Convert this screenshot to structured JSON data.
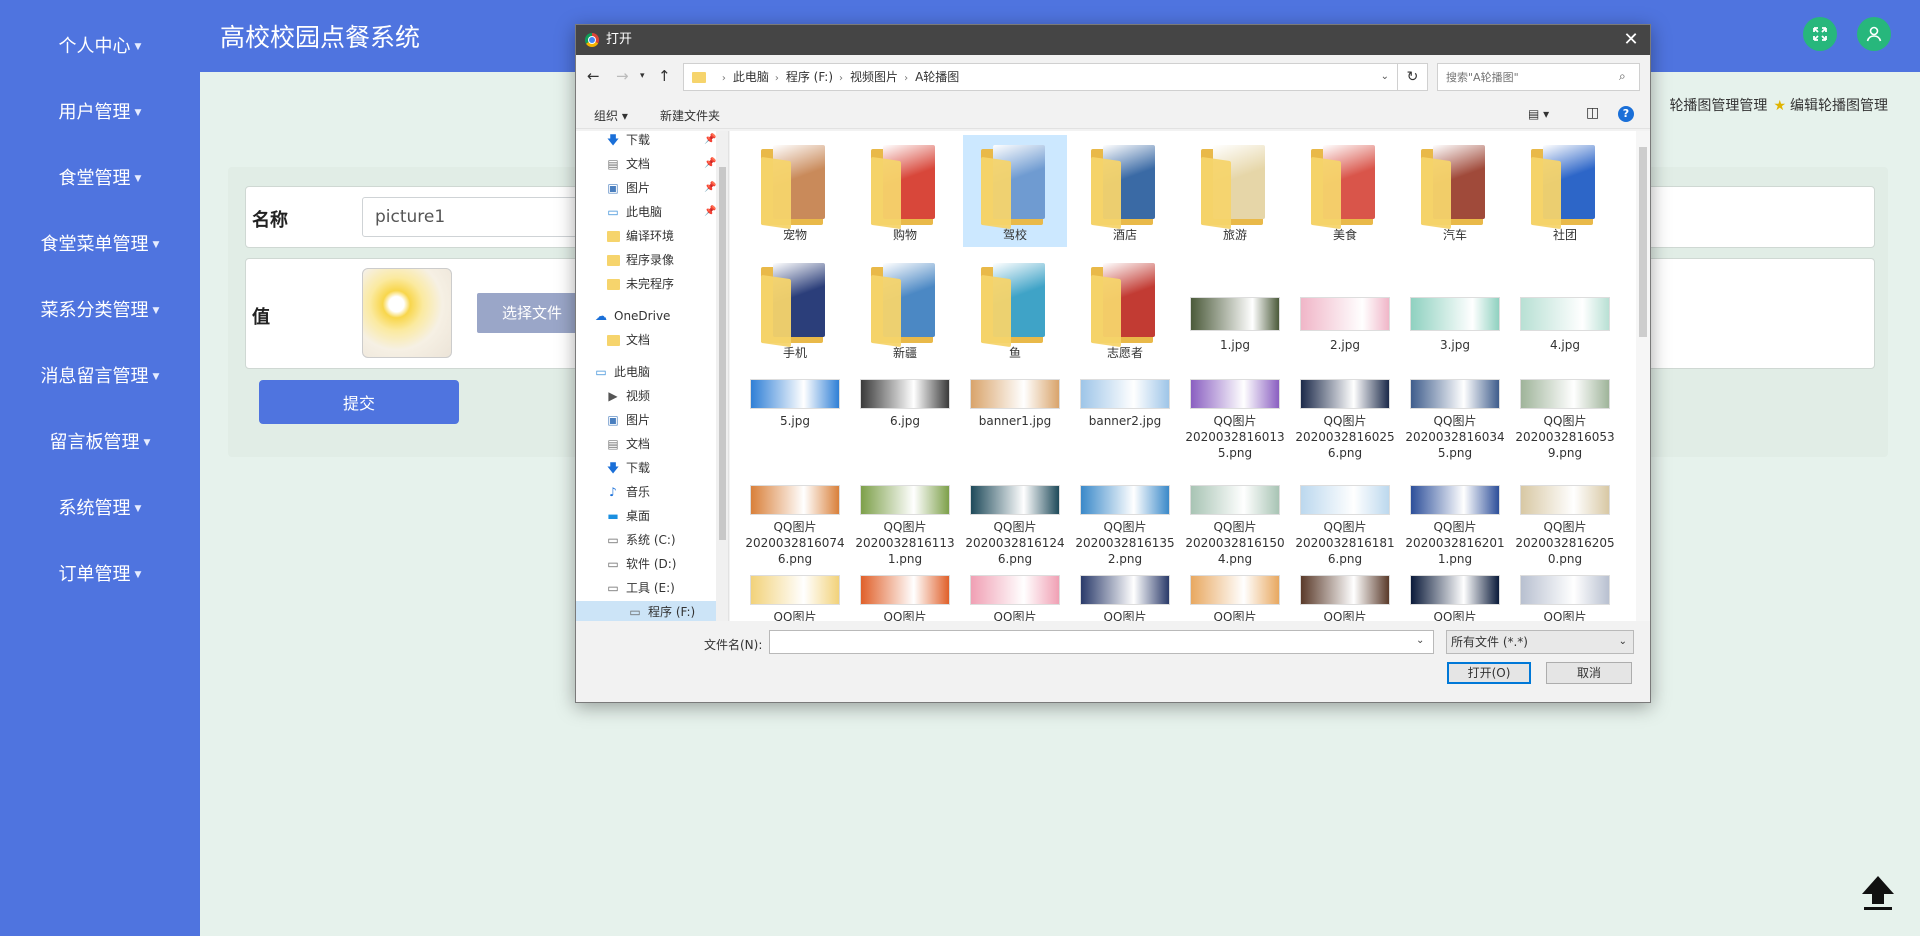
{
  "app": {
    "title": "高校校园点餐系统",
    "sidebar": [
      "个人中心",
      "用户管理",
      "食堂管理",
      "食堂菜单管理",
      "菜系分类管理",
      "消息留言管理",
      "留言板管理",
      "系统管理",
      "订单管理"
    ],
    "breadcrumb": {
      "current": "轮播图管理管理",
      "edit": "编辑轮播图管理"
    },
    "form": {
      "name_label": "名称",
      "name_value": "picture1",
      "value_label": "值",
      "file_button": "选择文件",
      "submit": "提交"
    },
    "colors": {
      "primary": "#4f74df",
      "accent": "#27b77c",
      "background": "#e6f2ec"
    }
  },
  "dialog": {
    "title": "打开",
    "path": [
      "此电脑",
      "程序 (F:)",
      "视频图片",
      "A轮播图"
    ],
    "search_placeholder": "搜索\"A轮播图\"",
    "toolbar": {
      "organize": "组织",
      "new_folder": "新建文件夹"
    },
    "nav": {
      "quick": [
        {
          "label": "下载",
          "icon": "download-arrow-icon",
          "pinned": true
        },
        {
          "label": "文档",
          "icon": "document-icon",
          "pinned": true
        },
        {
          "label": "图片",
          "icon": "picture-icon",
          "pinned": true
        },
        {
          "label": "此电脑",
          "icon": "monitor-icon",
          "pinned": true
        },
        {
          "label": "编译环境",
          "icon": "folder-icon",
          "pinned": false
        },
        {
          "label": "程序录像",
          "icon": "folder-icon",
          "pinned": false
        },
        {
          "label": "未完程序",
          "icon": "folder-icon",
          "pinned": false
        }
      ],
      "onedrive": "OneDrive",
      "onedrive_items": [
        "文档"
      ],
      "this_pc": "此电脑",
      "pc_items": [
        {
          "label": "视频",
          "icon": "video-icon"
        },
        {
          "label": "图片",
          "icon": "picture-icon"
        },
        {
          "label": "文档",
          "icon": "document-icon"
        },
        {
          "label": "下载",
          "icon": "download-arrow-icon"
        },
        {
          "label": "音乐",
          "icon": "music-icon"
        },
        {
          "label": "桌面",
          "icon": "desktop-icon"
        },
        {
          "label": "系统 (C:)",
          "icon": "drive-icon"
        },
        {
          "label": "软件 (D:)",
          "icon": "drive-icon"
        },
        {
          "label": "工具 (E:)",
          "icon": "drive-icon"
        },
        {
          "label": "程序 (F:)",
          "icon": "drive-icon"
        }
      ]
    },
    "folders": [
      {
        "name": "宠物",
        "color": "#c98a5a"
      },
      {
        "name": "购物",
        "color": "#d8473a"
      },
      {
        "name": "驾校",
        "color": "#6f9bd1"
      },
      {
        "name": "酒店",
        "color": "#3a6aa5"
      },
      {
        "name": "旅游",
        "color": "#e6d6a8"
      },
      {
        "name": "美食",
        "color": "#d9554a"
      },
      {
        "name": "汽车",
        "color": "#a04a3a"
      },
      {
        "name": "社团",
        "color": "#2d66c8"
      },
      {
        "name": "手机",
        "color": "#2b3e7a"
      },
      {
        "name": "新疆",
        "color": "#4b88c4"
      },
      {
        "name": "鱼",
        "color": "#3fa3c7"
      },
      {
        "name": "志愿者",
        "color": "#c23b33"
      }
    ],
    "files_row2": [
      {
        "name": "1.jpg",
        "color": "#4b5a3a"
      },
      {
        "name": "2.jpg",
        "color": "#f0b6c8"
      },
      {
        "name": "3.jpg",
        "color": "#8fd1c0"
      },
      {
        "name": "4.jpg",
        "color": "#b8e0d4"
      }
    ],
    "files_row3": [
      {
        "name": "5.jpg",
        "color": "#2f7fd6"
      },
      {
        "name": "6.jpg",
        "color": "#3a3a3a"
      },
      {
        "name": "banner1.jpg",
        "color": "#d9a46b"
      },
      {
        "name": "banner2.jpg",
        "color": "#9ec5e8"
      },
      {
        "name": "QQ图片\n2020032816013\n5.png",
        "color": "#8a5fc1"
      },
      {
        "name": "QQ图片\n2020032816025\n6.png",
        "color": "#1c2a4a"
      },
      {
        "name": "QQ图片\n2020032816034\n5.png",
        "color": "#3f5d8c"
      },
      {
        "name": "QQ图片\n2020032816053\n9.png",
        "color": "#9fb49a"
      }
    ],
    "files_row4": [
      {
        "name": "QQ图片\n2020032816074\n6.png",
        "color": "#d9803a"
      },
      {
        "name": "QQ图片\n2020032816113\n1.png",
        "color": "#7da04a"
      },
      {
        "name": "QQ图片\n2020032816124\n6.png",
        "color": "#1e4a5a"
      },
      {
        "name": "QQ图片\n2020032816135\n2.png",
        "color": "#3a89c9"
      },
      {
        "name": "QQ图片\n2020032816150\n4.png",
        "color": "#a8c4b4"
      },
      {
        "name": "QQ图片\n2020032816181\n6.png",
        "color": "#bcd8ee"
      },
      {
        "name": "QQ图片\n2020032816201\n1.png",
        "color": "#2d4f9a"
      },
      {
        "name": "QQ图片\n2020032816205\n0.png",
        "color": "#d8c8a4"
      }
    ],
    "files_row5": [
      {
        "name": "QQ图片",
        "color": "#f2d27a"
      },
      {
        "name": "QQ图片",
        "color": "#e0602a"
      },
      {
        "name": "QQ图片",
        "color": "#f0a0b4"
      },
      {
        "name": "QQ图片",
        "color": "#2a3a6a"
      },
      {
        "name": "QQ图片",
        "color": "#e8a860"
      },
      {
        "name": "QQ图片",
        "color": "#5a3a2a"
      },
      {
        "name": "QQ图片",
        "color": "#0a1a3a"
      },
      {
        "name": "QQ图片",
        "color": "#b8c0d0"
      }
    ],
    "footer": {
      "filename_label": "文件名(N):",
      "filename_value": "",
      "filetype": "所有文件 (*.*)",
      "open": "打开(O)",
      "cancel": "取消"
    }
  }
}
